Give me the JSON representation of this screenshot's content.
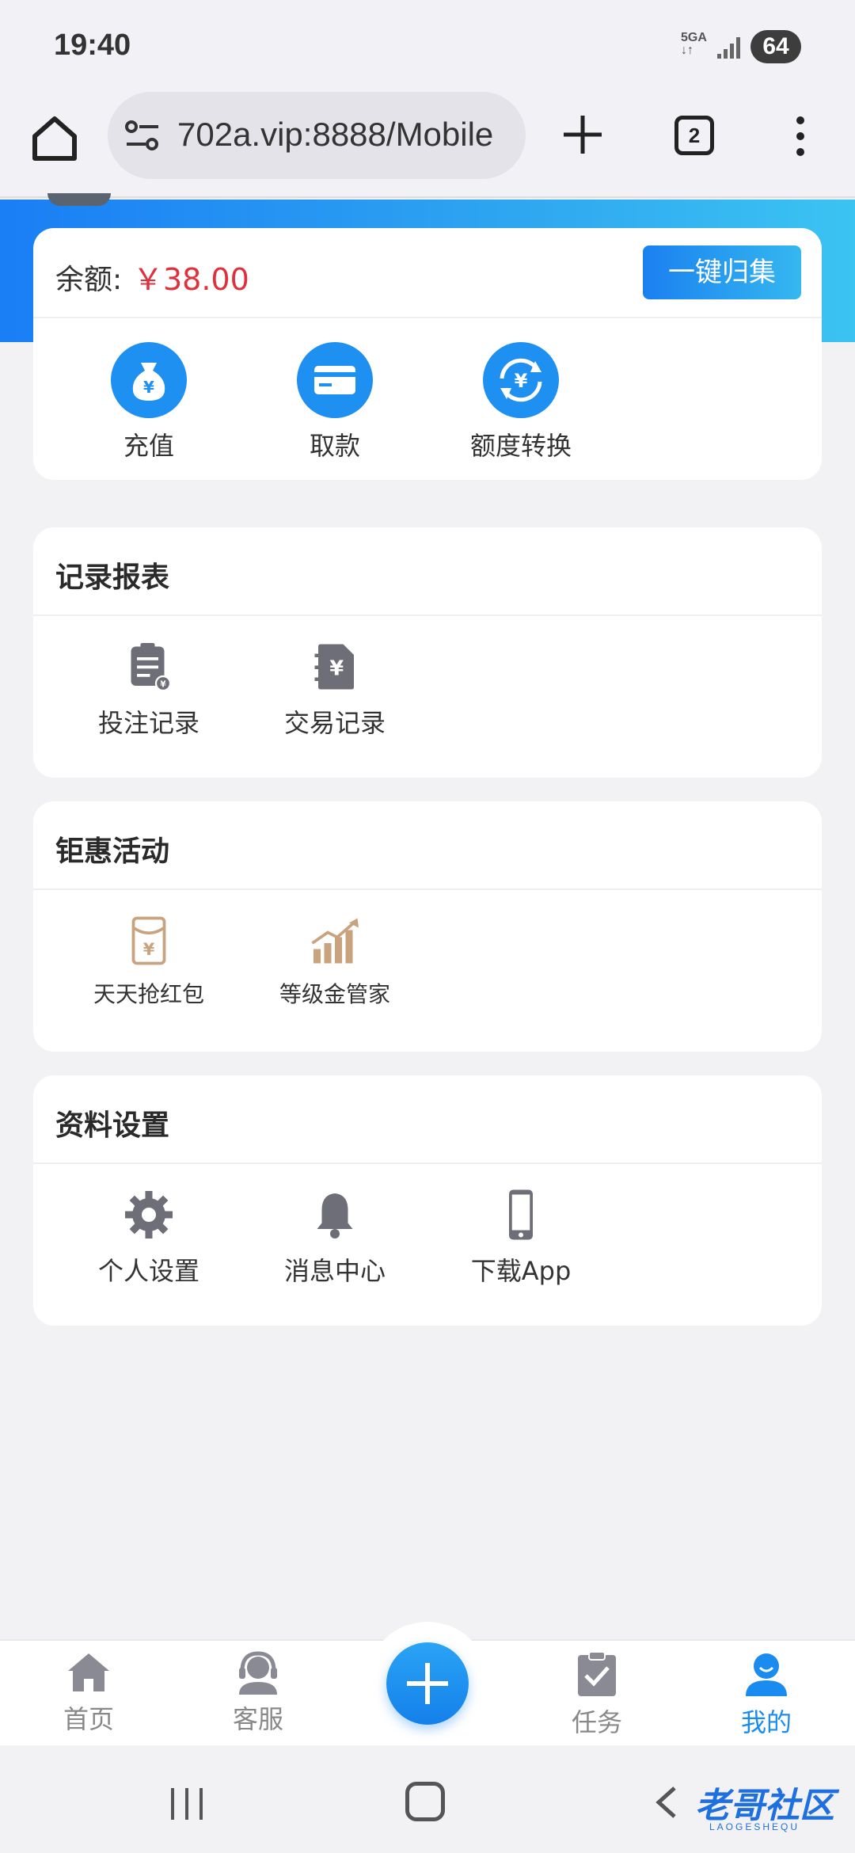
{
  "status": {
    "time": "19:40",
    "network": "5GA",
    "battery": "64"
  },
  "browser": {
    "url": "702a.vip:8888/Mobile",
    "tab_count": "2"
  },
  "balance": {
    "label": "余额:",
    "value": "￥38.00",
    "collect_button": "一键归集",
    "actions": [
      {
        "label": "充值",
        "icon": "money-bag-icon"
      },
      {
        "label": "取款",
        "icon": "card-icon"
      },
      {
        "label": "额度转换",
        "icon": "yuan-exchange-icon"
      }
    ]
  },
  "records": {
    "title": "记录报表",
    "items": [
      {
        "label": "投注记录",
        "icon": "clipboard-icon"
      },
      {
        "label": "交易记录",
        "icon": "yuan-notebook-icon"
      }
    ]
  },
  "promotions": {
    "title": "钜惠活动",
    "items": [
      {
        "label": "天天抢红包",
        "icon": "red-envelope-icon"
      },
      {
        "label": "等级金管家",
        "icon": "growth-chart-icon"
      }
    ]
  },
  "settings": {
    "title": "资料设置",
    "items": [
      {
        "label": "个人设置",
        "icon": "gear-icon"
      },
      {
        "label": "消息中心",
        "icon": "bell-icon"
      },
      {
        "label": "下载App",
        "icon": "phone-icon"
      }
    ]
  },
  "nav": {
    "items": [
      {
        "label": "首页"
      },
      {
        "label": "客服"
      },
      {
        "label": "任务"
      },
      {
        "label": "我的"
      }
    ],
    "active_color": "#1a8cf0"
  },
  "watermark": {
    "text": "老哥社区",
    "sub": "LAOGESHEQU"
  }
}
